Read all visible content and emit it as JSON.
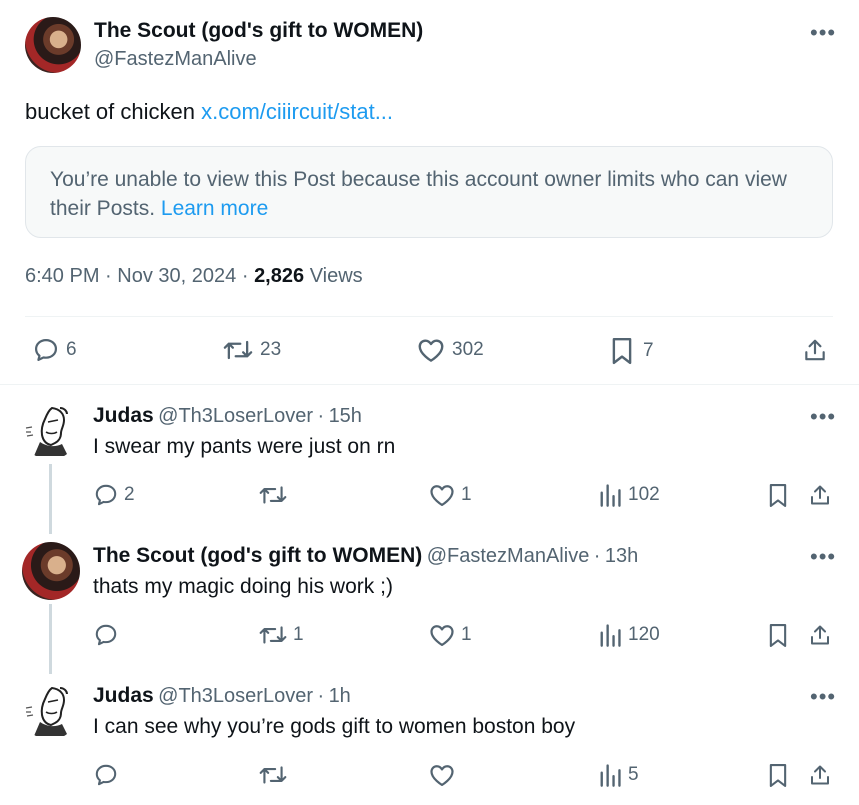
{
  "main_post": {
    "author_name": "The Scout (god's gift to WOMEN)",
    "author_handle": "@FastezManAlive",
    "text": "bucket of chicken",
    "link_text": "x.com/ciiircuit/stat...",
    "notice_text": "You’re unable to view this Post because this account owner limits who can view their Posts.",
    "notice_link": "Learn more",
    "time": "6:40 PM",
    "date": "Nov 30, 2024",
    "views_count": "2,826",
    "views_label": "Views",
    "replies": "6",
    "reposts": "23",
    "likes": "302",
    "bookmarks": "7"
  },
  "replies": [
    {
      "name": "Judas",
      "handle": "@Th3LoserLover",
      "time": "15h",
      "text": "I swear my pants were just on rn",
      "replies": "2",
      "reposts": "",
      "likes": "1",
      "views": "102"
    },
    {
      "name": "The Scout (god's gift to WOMEN)",
      "handle": "@FastezManAlive",
      "time": "13h",
      "text": "thats my magic doing his work ;)",
      "replies": "",
      "reposts": "1",
      "likes": "1",
      "views": "120"
    },
    {
      "name": "Judas",
      "handle": "@Th3LoserLover",
      "time": "1h",
      "text": "I can see why you’re gods gift to women boston boy",
      "replies": "",
      "reposts": "",
      "likes": "",
      "views": "5"
    }
  ],
  "separator": "·",
  "more_glyph": "•••"
}
